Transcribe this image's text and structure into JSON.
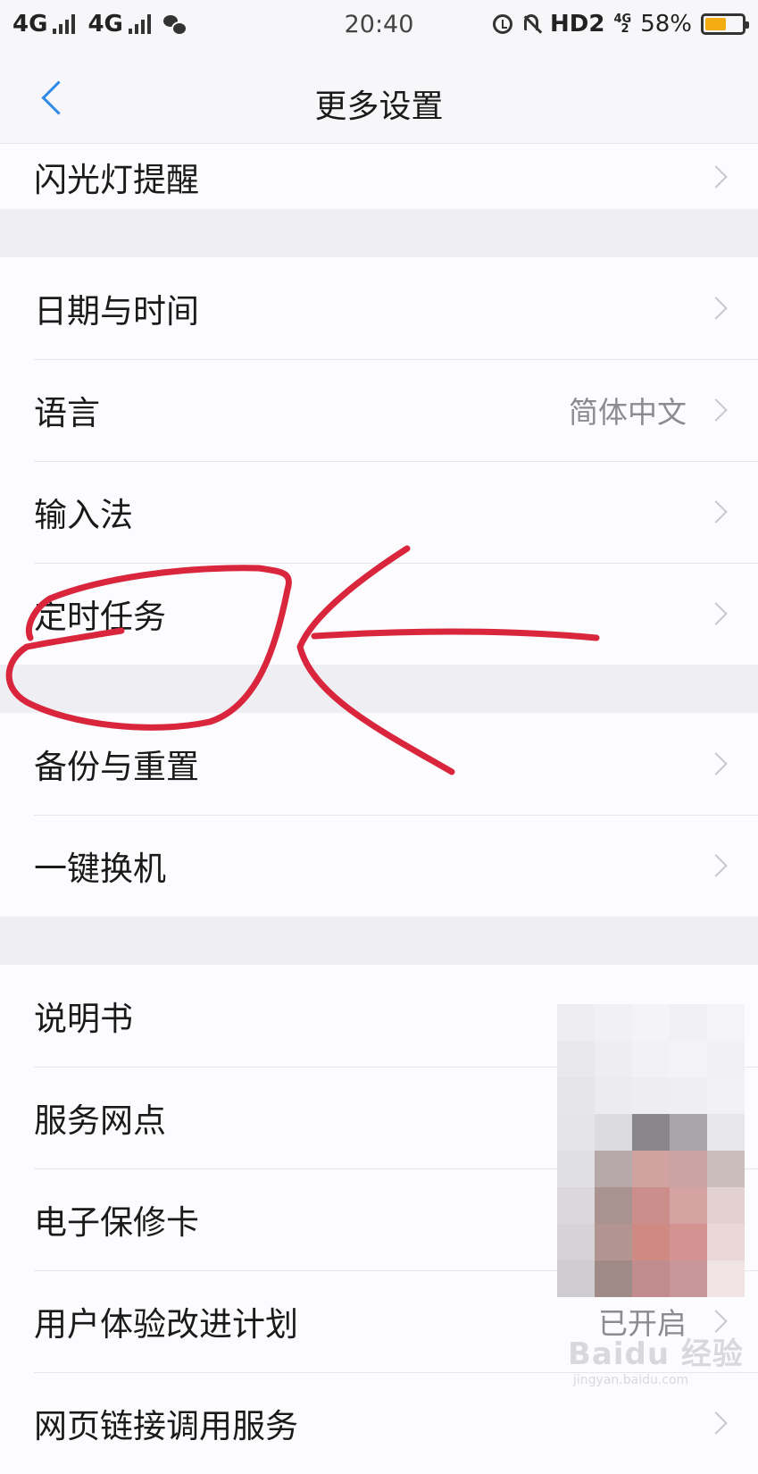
{
  "status_bar": {
    "signal_1": "4G",
    "signal_2": "4G",
    "time": "20:40",
    "hd_label": "HD2",
    "network_small_top": "4G",
    "network_small_bottom": "2",
    "battery_percent_text": "58%",
    "battery_level": 0.58,
    "battery_color": "#f3ad12",
    "icons": [
      "signal-bars-icon",
      "wechat-icon",
      "alarm-clock-icon",
      "bell-muted-icon",
      "battery-icon"
    ]
  },
  "header": {
    "title": "更多设置",
    "back_icon": "chevron-left-icon",
    "accent_color": "#2e8ae6"
  },
  "groups": [
    {
      "items": [
        {
          "label": "闪光灯提醒"
        }
      ]
    },
    {
      "items": [
        {
          "label": "日期与时间"
        },
        {
          "label": "语言",
          "value": "简体中文"
        },
        {
          "label": "输入法"
        },
        {
          "label": "定时任务"
        }
      ]
    },
    {
      "items": [
        {
          "label": "备份与重置"
        },
        {
          "label": "一键换机"
        }
      ]
    },
    {
      "items": [
        {
          "label": "说明书"
        },
        {
          "label": "服务网点"
        },
        {
          "label": "电子保修卡"
        },
        {
          "label": "用户体验改进计划",
          "value": "已开启"
        },
        {
          "label": "网页链接调用服务"
        }
      ]
    }
  ],
  "annotation": {
    "color": "#d9263d"
  },
  "watermark": {
    "main": "Baidu 经验",
    "sub": "jingyan.baidu.com"
  }
}
